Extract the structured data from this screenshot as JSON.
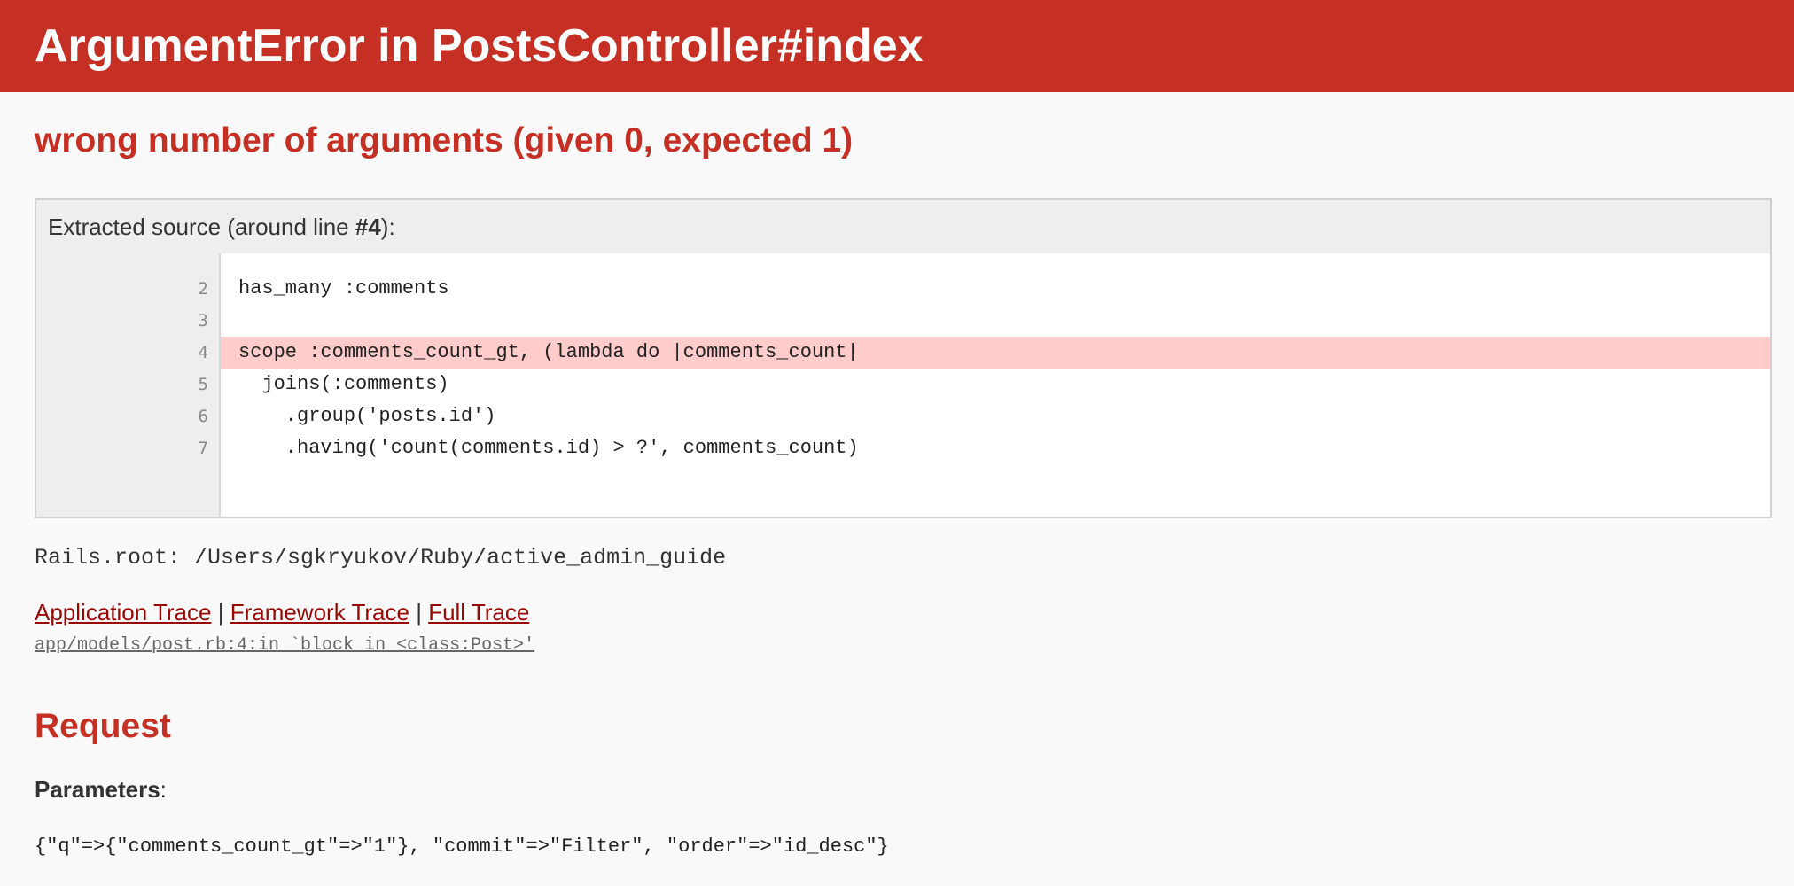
{
  "header": {
    "title": "ArgumentError in PostsController#index"
  },
  "error": {
    "message": "wrong number of arguments (given 0, expected 1)"
  },
  "source": {
    "caption_prefix": "Extracted source (around line ",
    "caption_line": "#4",
    "caption_suffix": "):",
    "line_numbers": [
      "2",
      "3",
      "4",
      "5",
      "6",
      "7"
    ],
    "lines": [
      "has_many :comments",
      "",
      "scope :comments_count_gt, (lambda do |comments_count|",
      "  joins(:comments)",
      "    .group('posts.id')",
      "    .having('count(comments.id) > ?', comments_count)"
    ],
    "highlighted_line": "4"
  },
  "rails_root": "Rails.root: /Users/sgkryukov/Ruby/active_admin_guide",
  "traces": {
    "application": "Application Trace",
    "framework": "Framework Trace",
    "full": "Full Trace",
    "separator": "|",
    "items": [
      "app/models/post.rb:4:in `block in <class:Post>'"
    ]
  },
  "request": {
    "title": "Request",
    "parameters_label": "Parameters",
    "parameters_colon": ":",
    "parameters_value": "{\"q\"=>{\"comments_count_gt\"=>\"1\"}, \"commit\"=>\"Filter\", \"order\"=>\"id_desc\"}"
  },
  "colors": {
    "header_bg": "#c52f24",
    "link": "#980905",
    "highlight": "#ffcccc"
  }
}
